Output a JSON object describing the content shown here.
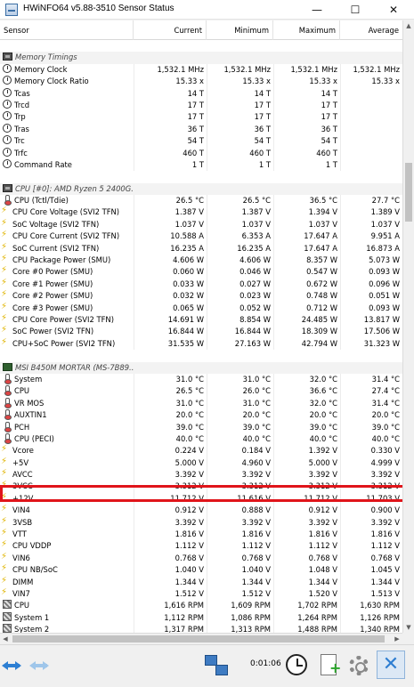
{
  "window": {
    "title": "HWiNFO64 v5.88-3510 Sensor Status",
    "minimize_glyph": "—",
    "maximize_glyph": "☐",
    "close_glyph": "✕"
  },
  "columns": {
    "sensor": "Sensor",
    "current": "Current",
    "minimum": "Minimum",
    "maximum": "Maximum",
    "average": "Average"
  },
  "rows": [
    {
      "kind": "blank"
    },
    {
      "kind": "group",
      "icon": "chip-icon",
      "name": "Memory Timings"
    },
    {
      "kind": "data",
      "icon": "clock-icon",
      "name": "Memory Clock",
      "current": "1,532.1 MHz",
      "minimum": "1,532.1 MHz",
      "maximum": "1,532.1 MHz",
      "average": "1,532.1 MHz"
    },
    {
      "kind": "data",
      "icon": "clock-icon",
      "name": "Memory Clock Ratio",
      "current": "15.33 x",
      "minimum": "15.33 x",
      "maximum": "15.33 x",
      "average": "15.33 x"
    },
    {
      "kind": "data",
      "icon": "clock-icon",
      "name": "Tcas",
      "current": "14 T",
      "minimum": "14 T",
      "maximum": "14 T",
      "average": ""
    },
    {
      "kind": "data",
      "icon": "clock-icon",
      "name": "Trcd",
      "current": "17 T",
      "minimum": "17 T",
      "maximum": "17 T",
      "average": ""
    },
    {
      "kind": "data",
      "icon": "clock-icon",
      "name": "Trp",
      "current": "17 T",
      "minimum": "17 T",
      "maximum": "17 T",
      "average": ""
    },
    {
      "kind": "data",
      "icon": "clock-icon",
      "name": "Tras",
      "current": "36 T",
      "minimum": "36 T",
      "maximum": "36 T",
      "average": ""
    },
    {
      "kind": "data",
      "icon": "clock-icon",
      "name": "Trc",
      "current": "54 T",
      "minimum": "54 T",
      "maximum": "54 T",
      "average": ""
    },
    {
      "kind": "data",
      "icon": "clock-icon",
      "name": "Trfc",
      "current": "460 T",
      "minimum": "460 T",
      "maximum": "460 T",
      "average": ""
    },
    {
      "kind": "data",
      "icon": "clock-icon",
      "name": "Command Rate",
      "current": "1 T",
      "minimum": "1 T",
      "maximum": "1 T",
      "average": ""
    },
    {
      "kind": "blank"
    },
    {
      "kind": "group",
      "icon": "chip-icon",
      "name": "CPU [#0]: AMD Ryzen 5 2400G..."
    },
    {
      "kind": "data",
      "icon": "thermometer-icon",
      "name": "CPU (Tctl/Tdie)",
      "current": "26.5 °C",
      "minimum": "26.5 °C",
      "maximum": "36.5 °C",
      "average": "27.7 °C"
    },
    {
      "kind": "data",
      "icon": "voltage-icon",
      "name": "CPU Core Voltage (SVI2 TFN)",
      "current": "1.387 V",
      "minimum": "1.387 V",
      "maximum": "1.394 V",
      "average": "1.389 V"
    },
    {
      "kind": "data",
      "icon": "voltage-icon",
      "name": "SoC Voltage (SVI2 TFN)",
      "current": "1.037 V",
      "minimum": "1.037 V",
      "maximum": "1.037 V",
      "average": "1.037 V"
    },
    {
      "kind": "data",
      "icon": "voltage-icon",
      "name": "CPU Core Current (SVI2 TFN)",
      "current": "10.588 A",
      "minimum": "6.353 A",
      "maximum": "17.647 A",
      "average": "9.951 A"
    },
    {
      "kind": "data",
      "icon": "voltage-icon",
      "name": "SoC Current (SVI2 TFN)",
      "current": "16.235 A",
      "minimum": "16.235 A",
      "maximum": "17.647 A",
      "average": "16.873 A"
    },
    {
      "kind": "data",
      "icon": "voltage-icon",
      "name": "CPU Package Power (SMU)",
      "current": "4.606 W",
      "minimum": "4.606 W",
      "maximum": "8.357 W",
      "average": "5.073 W"
    },
    {
      "kind": "data",
      "icon": "voltage-icon",
      "name": "Core #0 Power (SMU)",
      "current": "0.060 W",
      "minimum": "0.046 W",
      "maximum": "0.547 W",
      "average": "0.093 W"
    },
    {
      "kind": "data",
      "icon": "voltage-icon",
      "name": "Core #1 Power (SMU)",
      "current": "0.033 W",
      "minimum": "0.027 W",
      "maximum": "0.672 W",
      "average": "0.096 W"
    },
    {
      "kind": "data",
      "icon": "voltage-icon",
      "name": "Core #2 Power (SMU)",
      "current": "0.032 W",
      "minimum": "0.023 W",
      "maximum": "0.748 W",
      "average": "0.051 W"
    },
    {
      "kind": "data",
      "icon": "voltage-icon",
      "name": "Core #3 Power (SMU)",
      "current": "0.065 W",
      "minimum": "0.052 W",
      "maximum": "0.712 W",
      "average": "0.093 W"
    },
    {
      "kind": "data",
      "icon": "voltage-icon",
      "name": "CPU Core Power (SVI2 TFN)",
      "current": "14.691 W",
      "minimum": "8.854 W",
      "maximum": "24.485 W",
      "average": "13.817 W"
    },
    {
      "kind": "data",
      "icon": "voltage-icon",
      "name": "SoC Power (SVI2 TFN)",
      "current": "16.844 W",
      "minimum": "16.844 W",
      "maximum": "18.309 W",
      "average": "17.506 W"
    },
    {
      "kind": "data",
      "icon": "voltage-icon",
      "name": "CPU+SoC Power (SVI2 TFN)",
      "current": "31.535 W",
      "minimum": "27.163 W",
      "maximum": "42.794 W",
      "average": "31.323 W"
    },
    {
      "kind": "blank"
    },
    {
      "kind": "group",
      "icon": "motherboard-icon",
      "name": "MSI B450M MORTAR (MS-7B89..."
    },
    {
      "kind": "data",
      "icon": "thermometer-icon",
      "name": "System",
      "current": "31.0 °C",
      "minimum": "31.0 °C",
      "maximum": "32.0 °C",
      "average": "31.4 °C"
    },
    {
      "kind": "data",
      "icon": "thermometer-icon",
      "name": "CPU",
      "current": "26.5 °C",
      "minimum": "26.0 °C",
      "maximum": "36.6 °C",
      "average": "27.4 °C"
    },
    {
      "kind": "data",
      "icon": "thermometer-icon",
      "name": "VR MOS",
      "current": "31.0 °C",
      "minimum": "31.0 °C",
      "maximum": "32.0 °C",
      "average": "31.4 °C"
    },
    {
      "kind": "data",
      "icon": "thermometer-icon",
      "name": "AUXTIN1",
      "current": "20.0 °C",
      "minimum": "20.0 °C",
      "maximum": "20.0 °C",
      "average": "20.0 °C"
    },
    {
      "kind": "data",
      "icon": "thermometer-icon",
      "name": "PCH",
      "current": "39.0 °C",
      "minimum": "39.0 °C",
      "maximum": "39.0 °C",
      "average": "39.0 °C"
    },
    {
      "kind": "data",
      "icon": "thermometer-icon",
      "name": "CPU (PECI)",
      "current": "40.0 °C",
      "minimum": "40.0 °C",
      "maximum": "40.0 °C",
      "average": "40.0 °C"
    },
    {
      "kind": "data",
      "icon": "voltage-icon",
      "name": "Vcore",
      "current": "0.224 V",
      "minimum": "0.184 V",
      "maximum": "1.392 V",
      "average": "0.330 V"
    },
    {
      "kind": "data",
      "icon": "voltage-icon",
      "name": "+5V",
      "current": "5.000 V",
      "minimum": "4.960 V",
      "maximum": "5.000 V",
      "average": "4.999 V"
    },
    {
      "kind": "data",
      "icon": "voltage-icon",
      "name": "AVCC",
      "current": "3.392 V",
      "minimum": "3.392 V",
      "maximum": "3.392 V",
      "average": "3.392 V"
    },
    {
      "kind": "data",
      "icon": "voltage-icon",
      "name": "3VCC",
      "current": "3.312 V",
      "minimum": "3.312 V",
      "maximum": "3.312 V",
      "average": "3.312 V"
    },
    {
      "kind": "data",
      "icon": "voltage-icon",
      "name": "+12V",
      "current": "11.712 V",
      "minimum": "11.616 V",
      "maximum": "11.712 V",
      "average": "11.703 V"
    },
    {
      "kind": "data",
      "icon": "voltage-icon",
      "name": "VIN4",
      "current": "0.912 V",
      "minimum": "0.888 V",
      "maximum": "0.912 V",
      "average": "0.900 V"
    },
    {
      "kind": "data",
      "icon": "voltage-icon",
      "name": "3VSB",
      "current": "3.392 V",
      "minimum": "3.392 V",
      "maximum": "3.392 V",
      "average": "3.392 V"
    },
    {
      "kind": "data",
      "icon": "voltage-icon",
      "name": "VTT",
      "current": "1.816 V",
      "minimum": "1.816 V",
      "maximum": "1.816 V",
      "average": "1.816 V"
    },
    {
      "kind": "data",
      "icon": "voltage-icon",
      "name": "CPU VDDP",
      "current": "1.112 V",
      "minimum": "1.112 V",
      "maximum": "1.112 V",
      "average": "1.112 V"
    },
    {
      "kind": "data",
      "icon": "voltage-icon",
      "name": "VIN6",
      "current": "0.768 V",
      "minimum": "0.768 V",
      "maximum": "0.768 V",
      "average": "0.768 V"
    },
    {
      "kind": "data",
      "icon": "voltage-icon",
      "name": "CPU NB/SoC",
      "current": "1.040 V",
      "minimum": "1.040 V",
      "maximum": "1.048 V",
      "average": "1.045 V"
    },
    {
      "kind": "data",
      "icon": "voltage-icon",
      "name": "DIMM",
      "current": "1.344 V",
      "minimum": "1.344 V",
      "maximum": "1.344 V",
      "average": "1.344 V"
    },
    {
      "kind": "data",
      "icon": "voltage-icon",
      "name": "VIN7",
      "current": "1.512 V",
      "minimum": "1.512 V",
      "maximum": "1.520 V",
      "average": "1.513 V"
    },
    {
      "kind": "data",
      "icon": "fan-icon",
      "name": "CPU",
      "current": "1,616 RPM",
      "minimum": "1,609 RPM",
      "maximum": "1,702 RPM",
      "average": "1,630 RPM"
    },
    {
      "kind": "data",
      "icon": "fan-icon",
      "name": "System 1",
      "current": "1,112 RPM",
      "minimum": "1,086 RPM",
      "maximum": "1,264 RPM",
      "average": "1,126 RPM"
    },
    {
      "kind": "data",
      "icon": "fan-icon",
      "name": "System 2",
      "current": "1,317 RPM",
      "minimum": "1,313 RPM",
      "maximum": "1,488 RPM",
      "average": "1,340 RPM"
    }
  ],
  "toolbar": {
    "timer": "0:01:06",
    "close_glyph": "✕"
  },
  "colors": {
    "highlight_border": "#e0141a",
    "nav_blue": "#2d7fd3",
    "close_blue": "#2f7ed1"
  },
  "icons": {
    "scroll_up": "▲",
    "scroll_down": "▼",
    "scroll_left": "◀",
    "scroll_right": "▶"
  }
}
